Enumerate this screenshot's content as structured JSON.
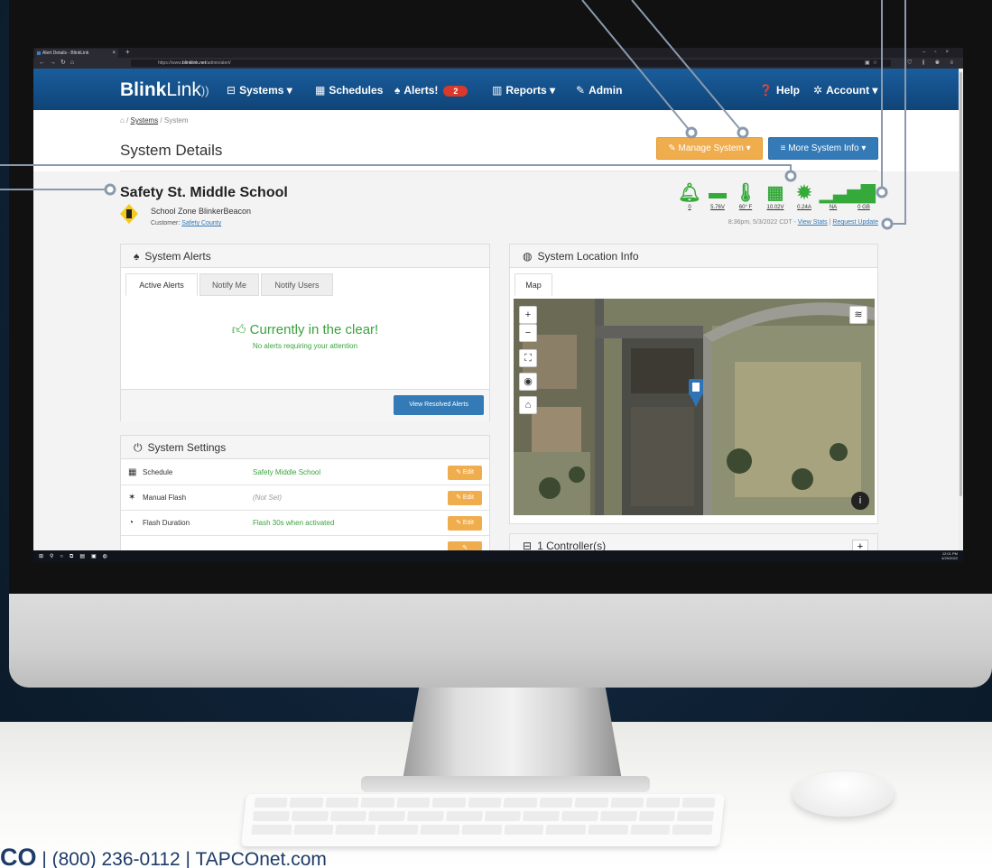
{
  "browser": {
    "tab_title": "Alert Details - BlinkLink",
    "url_prefix": "https://www.",
    "url_domain": "blinklink.net",
    "url_path": "/admin/alert/"
  },
  "nav": {
    "brand_bold": "Blink",
    "brand_light": "Link",
    "systems": "Systems",
    "schedules": "Schedules",
    "alerts": "Alerts!",
    "alerts_count": "2",
    "reports": "Reports",
    "admin": "Admin",
    "help": "Help",
    "account": "Account"
  },
  "breadcrumb": {
    "systems": "Systems",
    "system": "System"
  },
  "page": {
    "title": "System Details",
    "manage_button": "Manage System",
    "more_button": "More System Info"
  },
  "system": {
    "name": "Safety St. Middle School",
    "type": "School Zone BlinkerBeacon",
    "customer_label": "Customer:",
    "customer": "Safety County"
  },
  "stats": [
    {
      "icon": "bell-icon",
      "value": "0"
    },
    {
      "icon": "battery-icon",
      "value": "5.76V"
    },
    {
      "icon": "thermometer-icon",
      "value": "60° F"
    },
    {
      "icon": "solar-panel-icon",
      "value": "10.02V"
    },
    {
      "icon": "sun-icon",
      "value": "0.24A"
    },
    {
      "icon": "signal-icon",
      "value": "NA"
    },
    {
      "icon": "cloud-download-icon",
      "value": "0 GB"
    }
  ],
  "stats_footer": {
    "timestamp": "8:36pm, 5/3/2022 CDT",
    "view_stats": "View Stats",
    "request_update": "Request Update"
  },
  "alerts_panel": {
    "title": "System Alerts",
    "tabs": [
      "Active Alerts",
      "Notify Me",
      "Notify Users"
    ],
    "clear_message": "Currently in the clear!",
    "clear_sub": "No alerts requiring your attention",
    "resolved_button": "View Resolved Alerts"
  },
  "settings_panel": {
    "title": "System Settings",
    "edit_label": "Edit",
    "rows": [
      {
        "icon": "calendar-icon",
        "label": "Schedule",
        "value": "Safety Middle School",
        "muted": false
      },
      {
        "icon": "flash-icon",
        "label": "Manual Flash",
        "value": "(Not Set)",
        "muted": true
      },
      {
        "icon": "timer-icon",
        "label": "Flash Duration",
        "value": "Flash 30s when activated",
        "muted": false
      }
    ]
  },
  "location_panel": {
    "title": "System Location Info",
    "tab": "Map"
  },
  "controllers_panel": {
    "title": "1 Controller(s)"
  },
  "taskbar": {
    "time": "12:01 PM",
    "date": "4/20/2022"
  },
  "footer": {
    "logo": "CO",
    "phone": "| (800) 236-0112",
    "site": "| TAPCOnet.com"
  },
  "colors": {
    "nav_blue": "#0f4478",
    "status_green": "#35a93a",
    "manage_orange": "#f0ad4e",
    "primary_blue": "#337ab7",
    "alert_red": "#d9392b"
  }
}
